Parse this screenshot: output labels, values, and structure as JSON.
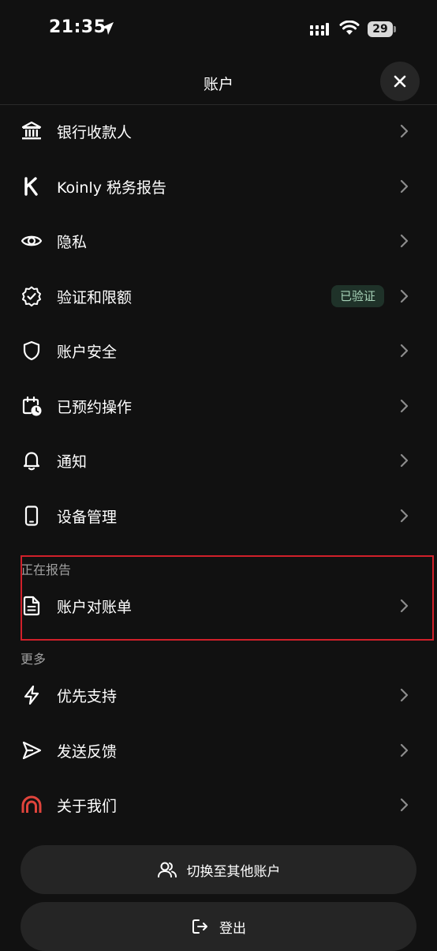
{
  "status_bar": {
    "time": "21:35",
    "battery": "29"
  },
  "header": {
    "title": "账户"
  },
  "menu": {
    "items": [
      {
        "label": "银行收款人",
        "icon": "bank-icon"
      },
      {
        "label": "Koinly 税务报告",
        "icon": "koinly-k-icon"
      },
      {
        "label": "隐私",
        "icon": "eye-icon"
      },
      {
        "label": "验证和限额",
        "icon": "verified-badge-icon",
        "badge": "已验证"
      },
      {
        "label": "账户安全",
        "icon": "shield-icon"
      },
      {
        "label": "已预约操作",
        "icon": "calendar-clock-icon"
      },
      {
        "label": "通知",
        "icon": "bell-icon"
      },
      {
        "label": "设备管理",
        "icon": "phone-icon"
      }
    ]
  },
  "reporting": {
    "header": "正在报告",
    "items": [
      {
        "label": "账户对账单",
        "icon": "document-icon"
      }
    ]
  },
  "more": {
    "header": "更多",
    "items": [
      {
        "label": "优先支持",
        "icon": "lightning-icon"
      },
      {
        "label": "发送反馈",
        "icon": "send-icon"
      },
      {
        "label": "关于我们",
        "icon": "brand-logo-icon"
      }
    ]
  },
  "actions": {
    "switch_account": "切换至其他账户",
    "logout": "登出"
  },
  "colors": {
    "background": "#111111",
    "badge_bg": "#1f3229",
    "badge_text": "#a7d3b8",
    "brand_red": "#e0443c",
    "highlight": "#d0202a"
  }
}
